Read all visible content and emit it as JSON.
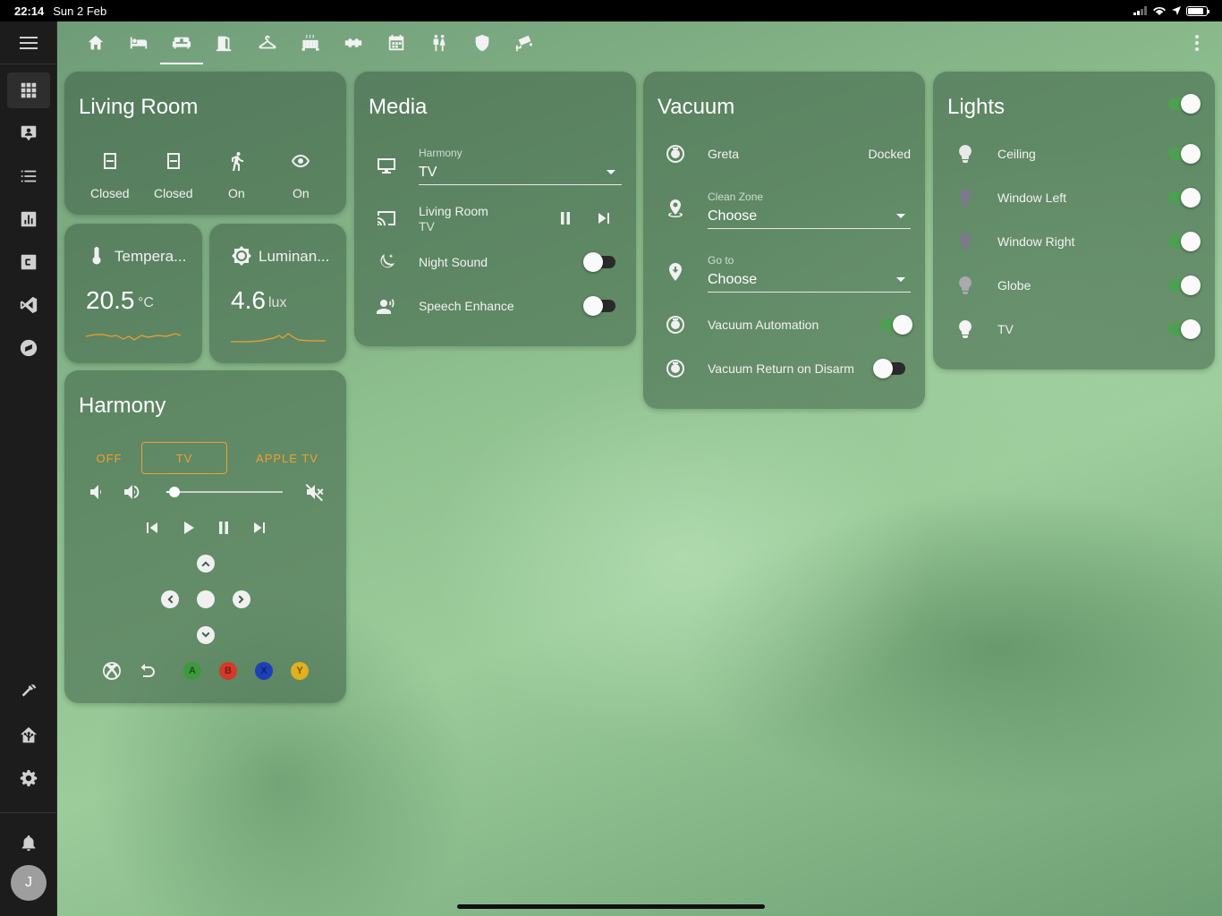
{
  "status": {
    "time": "22:14",
    "date": "Sun 2 Feb"
  },
  "sidebar": {
    "items": [
      {
        "icon": "grid-icon",
        "active": true
      },
      {
        "icon": "person-board-icon"
      },
      {
        "icon": "list-icon"
      },
      {
        "icon": "chart-icon"
      },
      {
        "icon": "c-box-icon"
      },
      {
        "icon": "vscode-icon"
      },
      {
        "icon": "compass-icon"
      }
    ],
    "bottom_items": [
      {
        "icon": "hammer-icon"
      },
      {
        "icon": "home-assistant-icon"
      },
      {
        "icon": "gear-icon"
      }
    ],
    "avatar_initial": "J"
  },
  "tabs": [
    "home-icon",
    "bed-icon",
    "sofa-icon",
    "door-icon",
    "hanger-icon",
    "radiator-icon",
    "pipe-icon",
    "calendar-icon",
    "people-icon",
    "shield-icon",
    "camera-icon"
  ],
  "living_room": {
    "title": "Living Room",
    "sensors": [
      {
        "icon": "door-closed-icon",
        "label": "Closed"
      },
      {
        "icon": "door-closed-icon",
        "label": "Closed"
      },
      {
        "icon": "walk-icon",
        "label": "On"
      },
      {
        "icon": "eye-icon",
        "label": "On"
      }
    ]
  },
  "temperature": {
    "name": "Tempera...",
    "value": "20.5",
    "unit": "°C"
  },
  "luminance": {
    "name": "Luminan...",
    "value": "4.6",
    "unit": "lux"
  },
  "media": {
    "title": "Media",
    "harmony_label": "Harmony",
    "harmony_value": "TV",
    "player_name": "Living Room",
    "player_sub": "TV",
    "night_sound": {
      "label": "Night Sound",
      "on": false
    },
    "speech_enhance": {
      "label": "Speech Enhance",
      "on": false
    }
  },
  "vacuum": {
    "title": "Vacuum",
    "name": "Greta",
    "state": "Docked",
    "clean_zone_label": "Clean Zone",
    "clean_zone_value": "Choose",
    "goto_label": "Go to",
    "goto_value": "Choose",
    "automation": {
      "label": "Vacuum Automation",
      "on": true
    },
    "return_on_disarm": {
      "label": "Vacuum Return on Disarm",
      "on": false
    }
  },
  "lights": {
    "title": "Lights",
    "all_on": true,
    "items": [
      {
        "label": "Ceiling",
        "on": true
      },
      {
        "label": "Window Left",
        "on": true
      },
      {
        "label": "Window Right",
        "on": true
      },
      {
        "label": "Globe",
        "on": true
      },
      {
        "label": "TV",
        "on": true
      }
    ]
  },
  "harmony": {
    "title": "Harmony",
    "activities": [
      "OFF",
      "TV",
      "APPLE TV"
    ],
    "selected_activity": "TV",
    "volume": 0.07,
    "buttons": {
      "a": "A",
      "b": "B",
      "x": "X",
      "y": "Y"
    },
    "colors": {
      "a": "#3d9a3d",
      "b": "#d23a2a",
      "x": "#1f3fb8",
      "y": "#e0b020"
    }
  }
}
